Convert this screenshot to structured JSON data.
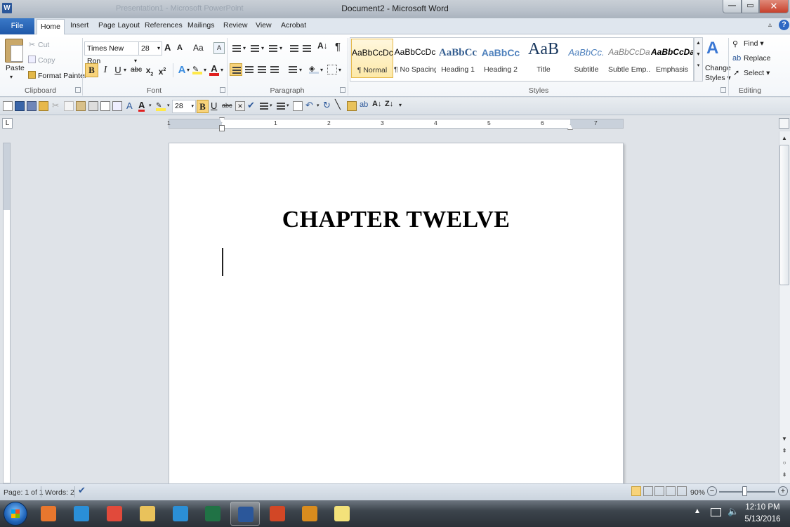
{
  "window": {
    "app_icon_label": "W",
    "ghost_title": "Presentation1 - Microsoft PowerPoint",
    "title": "Document2 - Microsoft Word",
    "min": "—",
    "max": "▭",
    "close": "✕"
  },
  "tabs": [
    "File",
    "Home",
    "Insert",
    "Page Layout",
    "References",
    "Mailings",
    "Review",
    "View",
    "Acrobat"
  ],
  "help": "?",
  "ribbon_min": "▵",
  "clipboard": {
    "paste": "Paste",
    "cut": "Cut",
    "copy": "Copy",
    "format_painter": "Format Painter",
    "group_label": "Clipboard"
  },
  "font": {
    "font_name": "Times New Ron",
    "font_size": "28",
    "grow": "A",
    "shrink": "A",
    "change_case": "Aa",
    "bold": "B",
    "italic": "I",
    "underline": "U",
    "strike": "abc",
    "subscript": "x",
    "superscript": "x",
    "text_effects": "A",
    "font_color": "A",
    "group_label": "Font"
  },
  "paragraph": {
    "pilcrow": "¶",
    "group_label": "Paragraph"
  },
  "styles": {
    "tiles": [
      {
        "preview": "AaBbCcDc",
        "name": "¶ Normal"
      },
      {
        "preview": "AaBbCcDc",
        "name": "¶ No Spacing"
      },
      {
        "preview": "AaBbCc",
        "name": "Heading 1"
      },
      {
        "preview": "AaBbCc",
        "name": "Heading 2"
      },
      {
        "preview": "AaB",
        "name": "Title"
      },
      {
        "preview": "AaBbCc.",
        "name": "Subtitle"
      },
      {
        "preview": "AaBbCcDa",
        "name": "Subtle Emp..."
      },
      {
        "preview": "AaBbCcDa",
        "name": "Emphasis"
      }
    ],
    "change_styles_line1": "Change",
    "change_styles_line2": "Styles",
    "group_label": "Styles"
  },
  "editing": {
    "find": "Find",
    "replace": "Replace",
    "select": "Select",
    "group_label": "Editing"
  },
  "qat": {
    "font_size": "28",
    "bold": "B",
    "underline": "U",
    "strike": "abc"
  },
  "ruler": {
    "tab_selector": "L",
    "numbers": [
      "1",
      "1",
      "2",
      "3",
      "4",
      "5",
      "6",
      "7"
    ]
  },
  "document": {
    "heading": "CHAPTER TWELVE"
  },
  "status": {
    "page": "Page: 1 of 1",
    "words": "Words: 2",
    "zoom": "90%",
    "zoom_out": "−",
    "zoom_in": "+"
  },
  "taskbar": {
    "time": "12:10 PM",
    "date": "5/13/2016",
    "tray_arrow": "▲",
    "apps": [
      {
        "name": "media-player",
        "color": "#e8772e",
        "open": false
      },
      {
        "name": "internet-explorer",
        "color": "#2a8fd8",
        "open": false
      },
      {
        "name": "chrome",
        "color": "#e14a3b",
        "open": false
      },
      {
        "name": "file-explorer",
        "color": "#e9c25b",
        "open": false
      },
      {
        "name": "network-app",
        "color": "#2b8fd6",
        "open": false
      },
      {
        "name": "excel",
        "color": "#207245",
        "open": false
      },
      {
        "name": "word",
        "color": "#2b579a",
        "open": true
      },
      {
        "name": "powerpoint",
        "color": "#d24726",
        "open": false
      },
      {
        "name": "screen-recorder",
        "color": "#d98c1e",
        "open": false
      },
      {
        "name": "sticky-notes",
        "color": "#f3e27a",
        "open": false
      }
    ]
  }
}
